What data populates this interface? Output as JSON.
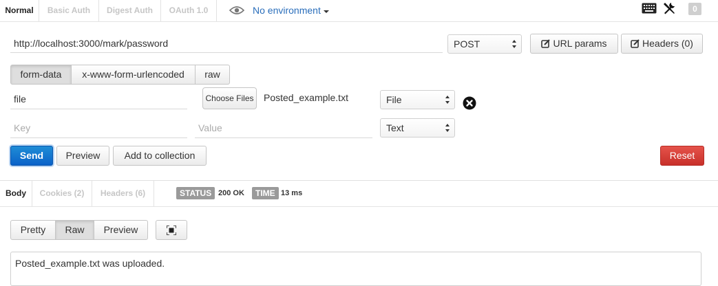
{
  "auth_tabs": [
    {
      "label": "Normal",
      "active": true
    },
    {
      "label": "Basic Auth",
      "active": false
    },
    {
      "label": "Digest Auth",
      "active": false
    },
    {
      "label": "OAuth 1.0",
      "active": false
    }
  ],
  "environment": {
    "label": "No environment",
    "icon": "eye-icon"
  },
  "toolbar_right": {
    "keyboard_icon": "keyboard-icon",
    "tools_icon": "tools-icon",
    "count": "0"
  },
  "request": {
    "url": "http://localhost:3000/mark/password",
    "method": "POST",
    "url_params_label": "URL params",
    "headers_label": "Headers (0)"
  },
  "body_modes": [
    {
      "label": "form-data",
      "active": true
    },
    {
      "label": "x-www-form-urlencoded",
      "active": false
    },
    {
      "label": "raw",
      "active": false
    }
  ],
  "form_rows": [
    {
      "key": "file",
      "choose_label": "Choose Files",
      "file_name": "Posted_example.txt",
      "type": "File"
    },
    {
      "key_placeholder": "Key",
      "value_placeholder": "Value",
      "type": "Text"
    }
  ],
  "actions": {
    "send": "Send",
    "preview": "Preview",
    "add_to_collection": "Add to collection",
    "reset": "Reset"
  },
  "response_tabs": [
    {
      "label": "Body",
      "active": true
    },
    {
      "label": "Cookies (2)",
      "active": false
    },
    {
      "label": "Headers (6)",
      "active": false
    }
  ],
  "status": {
    "label": "STATUS",
    "value": "200 OK"
  },
  "time": {
    "label": "TIME",
    "value": "13 ms"
  },
  "view_modes": [
    {
      "label": "Pretty",
      "active": false
    },
    {
      "label": "Raw",
      "active": true
    },
    {
      "label": "Preview",
      "active": false
    }
  ],
  "response_text": "Posted_example.txt was uploaded.",
  "colors": {
    "send": "#0b62c8",
    "reset": "#c8302a",
    "link": "#2a6ebb"
  }
}
